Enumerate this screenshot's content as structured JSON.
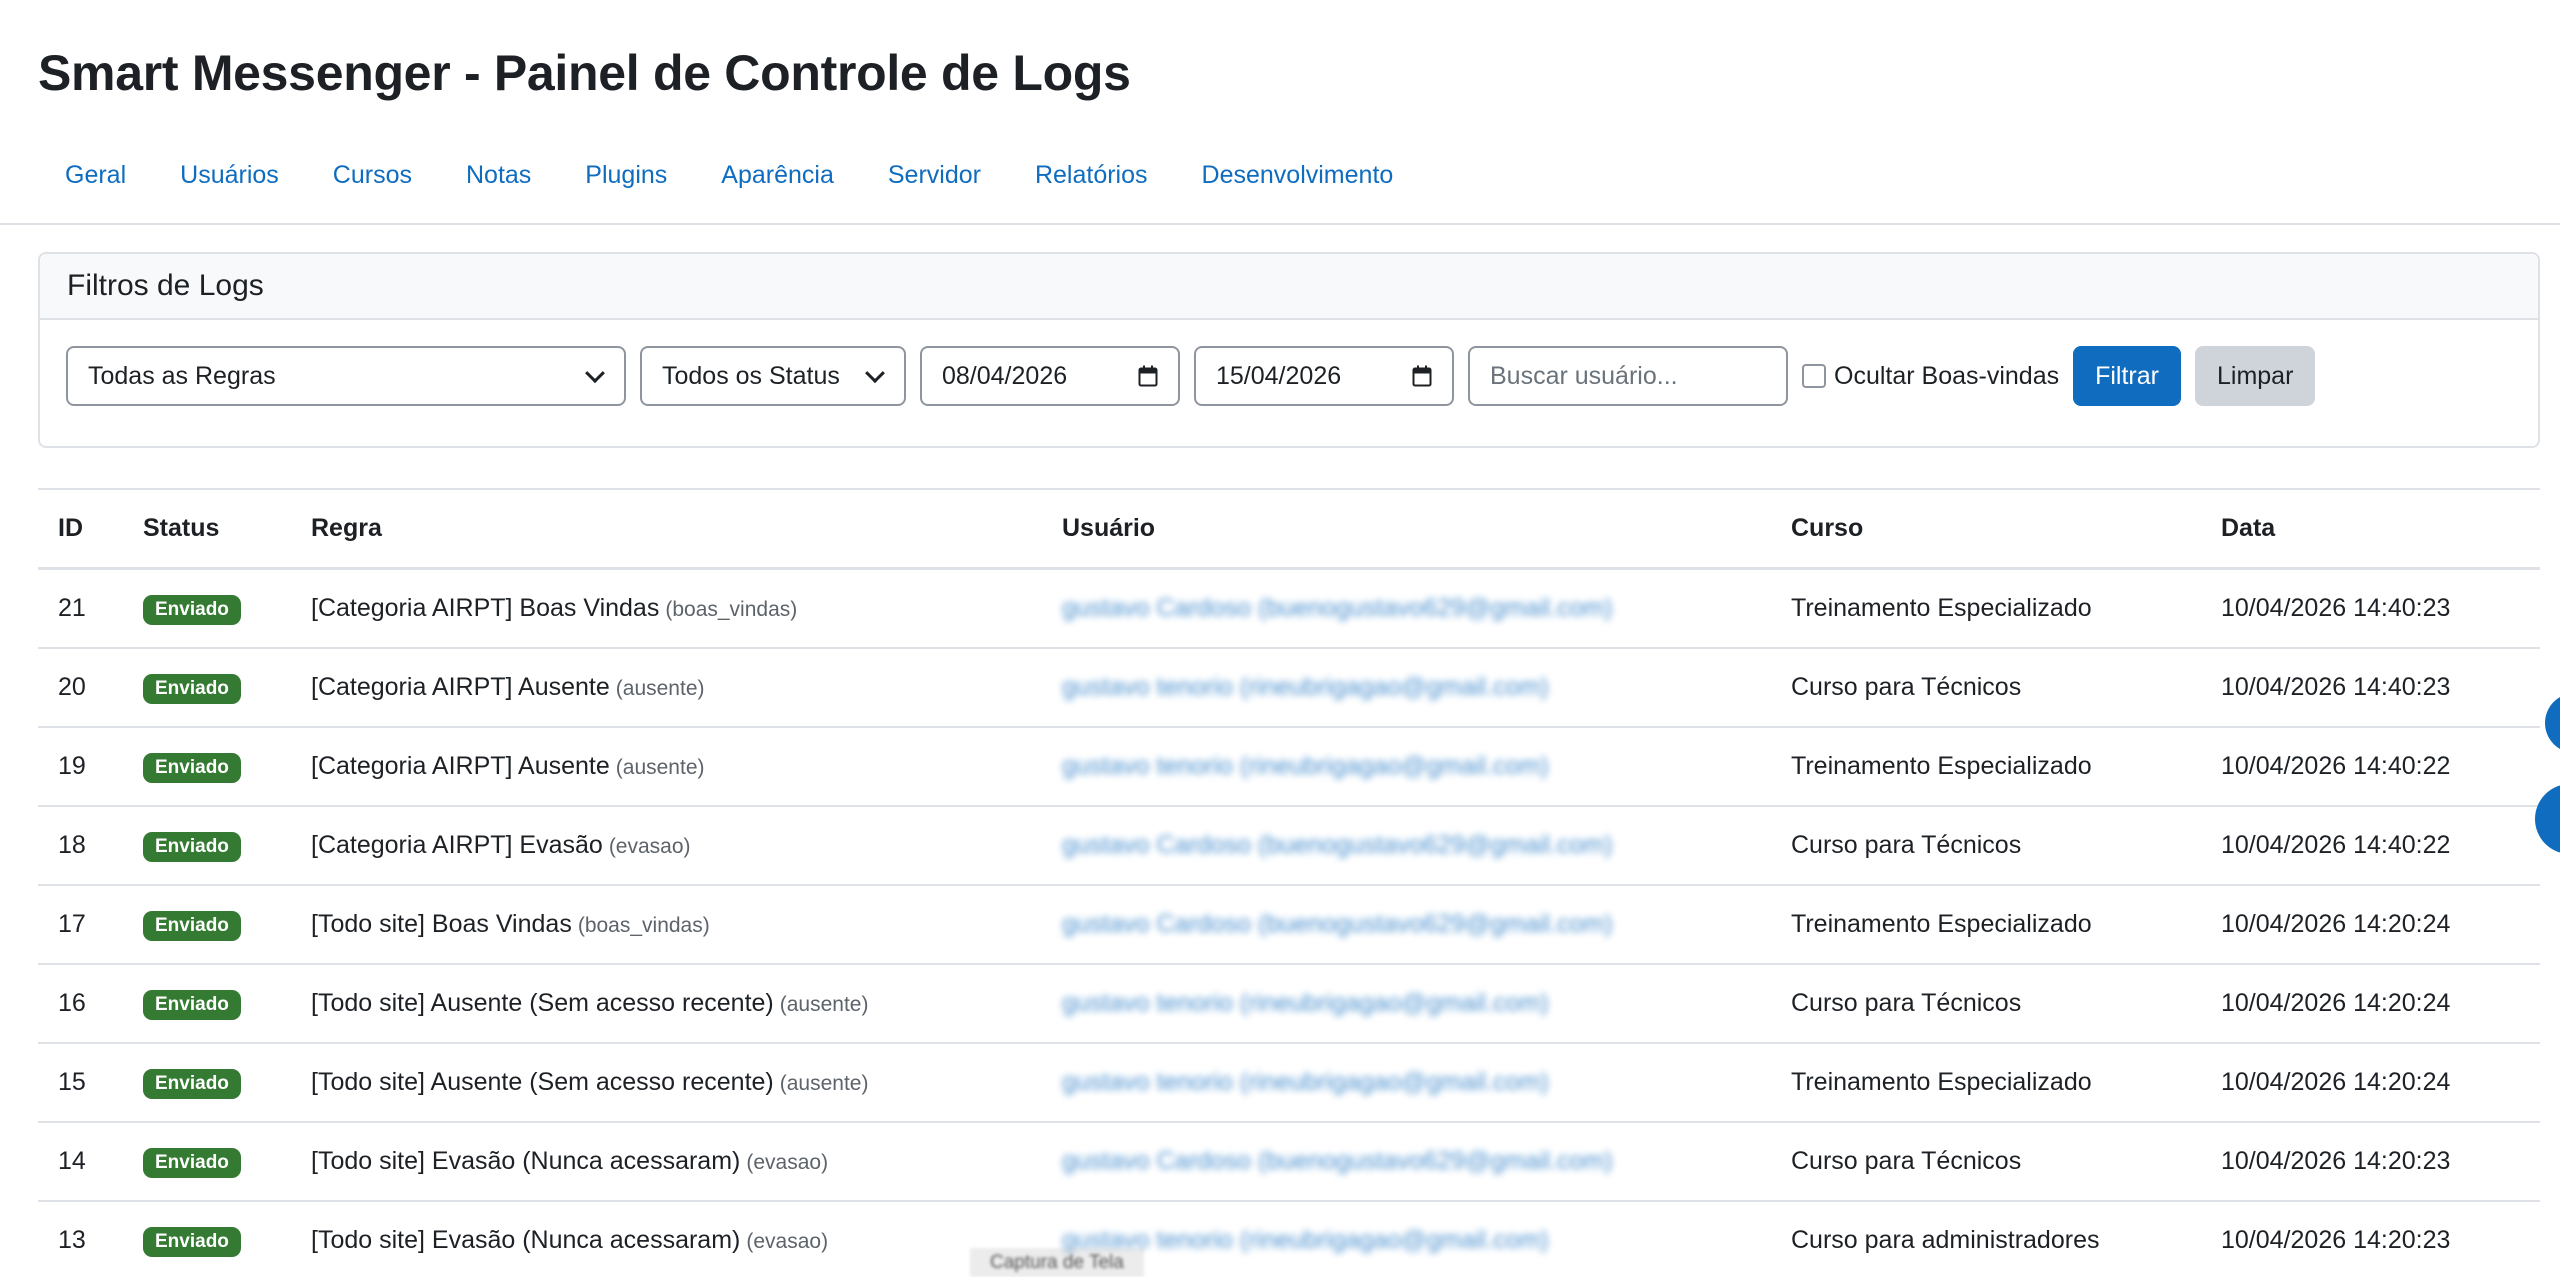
{
  "page": {
    "title": "Smart Messenger - Painel de Controle de Logs"
  },
  "nav": {
    "items": [
      "Geral",
      "Usuários",
      "Cursos",
      "Notas",
      "Plugins",
      "Aparência",
      "Servidor",
      "Relatórios",
      "Desenvolvimento"
    ]
  },
  "filters": {
    "title": "Filtros de Logs",
    "rule_select": "Todas as Regras",
    "status_select": "Todos os Status",
    "date_from": "08/04/2026",
    "date_to": "15/04/2026",
    "search_placeholder": "Buscar usuário...",
    "hide_welcome_label": "Ocultar Boas-vindas",
    "hide_welcome_checked": false,
    "filter_button": "Filtrar",
    "clear_button": "Limpar"
  },
  "table": {
    "headers": {
      "id": "ID",
      "status": "Status",
      "regra": "Regra",
      "usuario": "Usuário",
      "curso": "Curso",
      "data": "Data"
    },
    "rows": [
      {
        "id": "21",
        "status": "Enviado",
        "regra": "[Categoria AIRPT] Boas Vindas",
        "code": "(boas_vindas)",
        "usuario": "gustavo Cardoso (buenogustavo629@gmail.com)",
        "curso": "Treinamento Especializado",
        "data": "10/04/2026 14:40:23"
      },
      {
        "id": "20",
        "status": "Enviado",
        "regra": "[Categoria AIRPT] Ausente",
        "code": "(ausente)",
        "usuario": "gustavo tenorio (rineubrigagao@gmail.com)",
        "curso": "Curso para Técnicos",
        "data": "10/04/2026 14:40:23"
      },
      {
        "id": "19",
        "status": "Enviado",
        "regra": "[Categoria AIRPT] Ausente",
        "code": "(ausente)",
        "usuario": "gustavo tenorio (rineubrigagao@gmail.com)",
        "curso": "Treinamento Especializado",
        "data": "10/04/2026 14:40:22"
      },
      {
        "id": "18",
        "status": "Enviado",
        "regra": "[Categoria AIRPT] Evasão",
        "code": "(evasao)",
        "usuario": "gustavo Cardoso (buenogustavo629@gmail.com)",
        "curso": "Curso para Técnicos",
        "data": "10/04/2026 14:40:22"
      },
      {
        "id": "17",
        "status": "Enviado",
        "regra": "[Todo site] Boas Vindas",
        "code": "(boas_vindas)",
        "usuario": "gustavo Cardoso (buenogustavo629@gmail.com)",
        "curso": "Treinamento Especializado",
        "data": "10/04/2026 14:20:24"
      },
      {
        "id": "16",
        "status": "Enviado",
        "regra": "[Todo site] Ausente (Sem acesso recente)",
        "code": "(ausente)",
        "usuario": "gustavo tenorio (rineubrigagao@gmail.com)",
        "curso": "Curso para Técnicos",
        "data": "10/04/2026 14:20:24"
      },
      {
        "id": "15",
        "status": "Enviado",
        "regra": "[Todo site] Ausente (Sem acesso recente)",
        "code": "(ausente)",
        "usuario": "gustavo tenorio (rineubrigagao@gmail.com)",
        "curso": "Treinamento Especializado",
        "data": "10/04/2026 14:20:24"
      },
      {
        "id": "14",
        "status": "Enviado",
        "regra": "[Todo site] Evasão (Nunca acessaram)",
        "code": "(evasao)",
        "usuario": "gustavo Cardoso (buenogustavo629@gmail.com)",
        "curso": "Curso para Técnicos",
        "data": "10/04/2026 14:20:23"
      },
      {
        "id": "13",
        "status": "Enviado",
        "regra": "[Todo site] Evasão (Nunca acessaram)",
        "code": "(evasao)",
        "usuario": "gustavo tenorio (rineubrigagao@gmail.com)",
        "curso": "Curso para administradores",
        "data": "10/04/2026 14:20:23"
      }
    ]
  },
  "overlay": {
    "capture_label": "Captura de Tela"
  },
  "colors": {
    "primary": "#0f6cbf",
    "success_badge": "#357a32",
    "secondary_button": "#ced4da"
  }
}
